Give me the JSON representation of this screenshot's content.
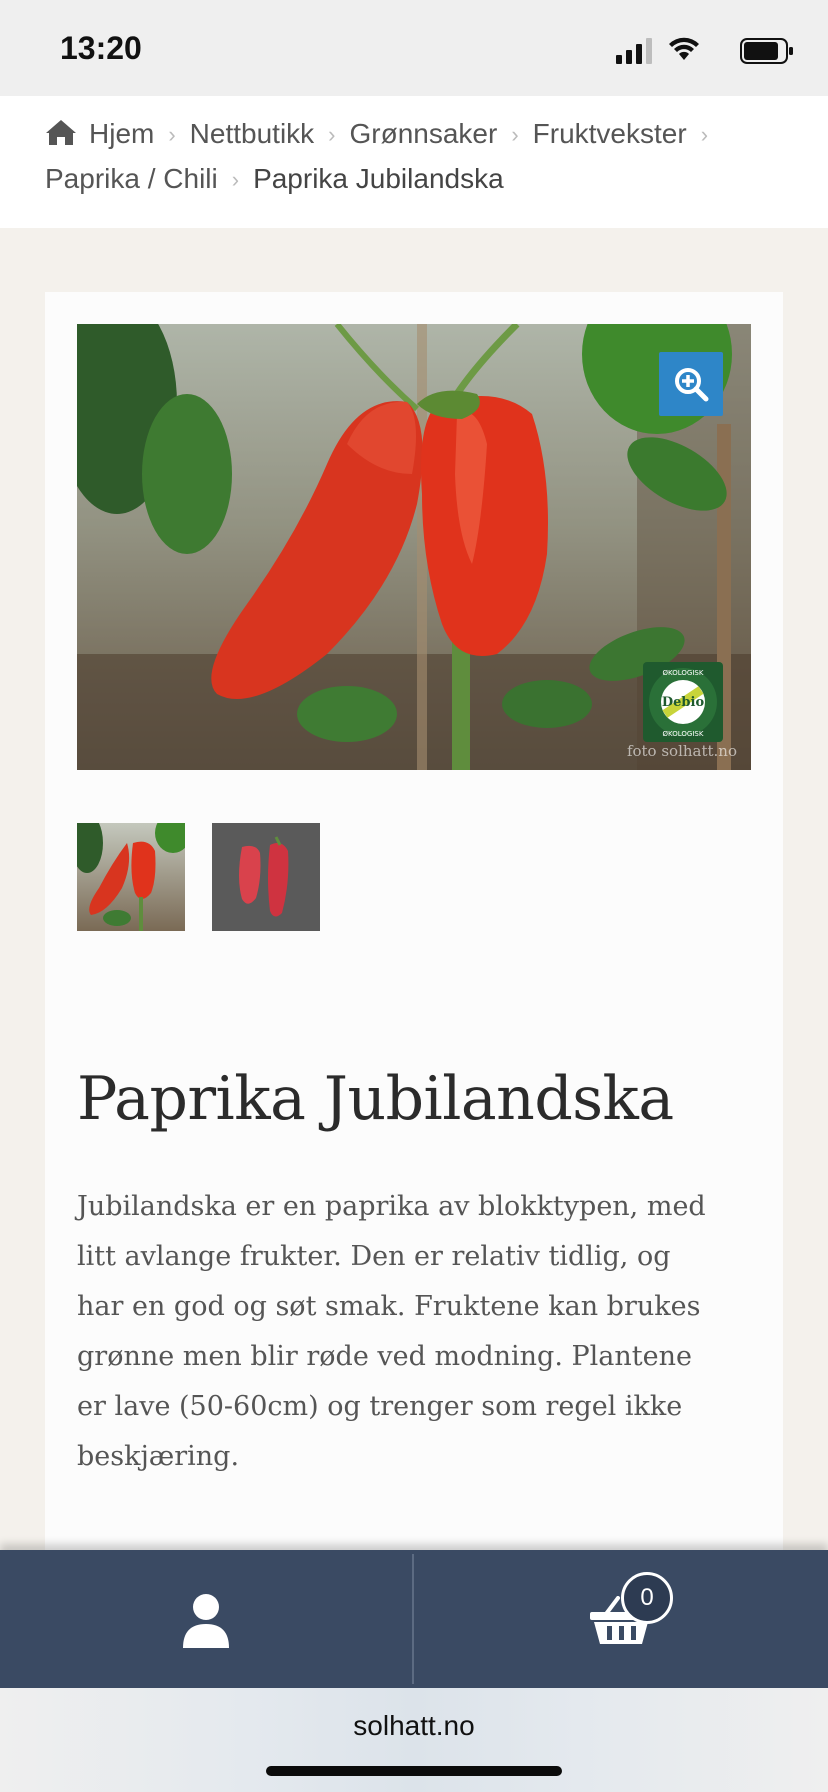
{
  "status_bar": {
    "time": "13:20"
  },
  "breadcrumb": {
    "items": [
      "Hjem",
      "Nettbutikk",
      "Grønnsaker",
      "Fruktvekster",
      "Paprika / Chili"
    ],
    "current": "Paprika Jubilandska",
    "icons": [
      "home-icon",
      "chevron-right-icon"
    ]
  },
  "product": {
    "title": "Paprika Jubilandska",
    "description": "Jubilandska er en paprika av blokktypen, med litt avlange frukter. Den er relativ tidlig, og har en god og søt smak. Fruktene kan brukes grønne men blir røde ved modning. Plantene er lave (50-60cm) og trenger som regel ikke beskjæring.",
    "image_watermark": "foto solhatt.no",
    "badge": {
      "top_text": "ØKOLOGISK",
      "center_text": "Debio",
      "bottom_text": "ØKOLOGISK"
    },
    "thumbnail_count": 2
  },
  "bottom_nav": {
    "account_icon": "user-icon",
    "cart_icon": "basket-icon",
    "cart_count": "0"
  },
  "browser": {
    "url": "solhatt.no"
  },
  "colors": {
    "nav_bg": "#3a4a63",
    "zoom_button": "#2e86c8",
    "page_bg": "#f4f1ec",
    "badge_green": "#1f5a2e"
  }
}
